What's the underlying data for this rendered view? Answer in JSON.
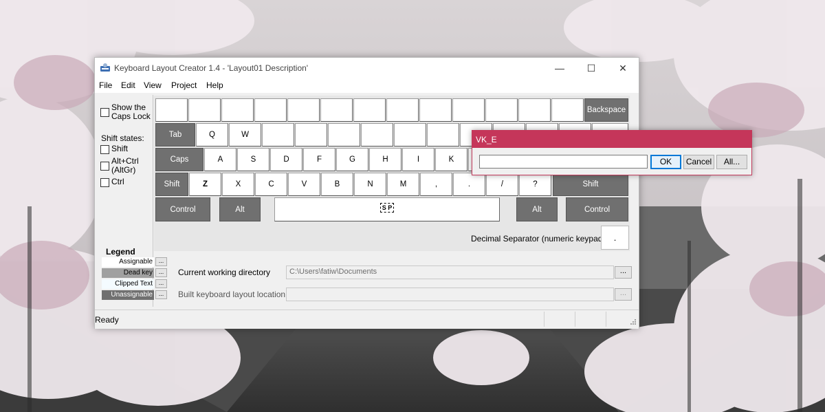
{
  "window": {
    "title": "Keyboard Layout Creator 1.4 - 'Layout01 Description'",
    "minimize_glyph": "—",
    "maximize_glyph": "☐",
    "close_glyph": "✕"
  },
  "menu": [
    "File",
    "Edit",
    "View",
    "Project",
    "Help"
  ],
  "options": {
    "caps_lock_label": [
      "Show the",
      "Caps Lock"
    ],
    "shift_states_label": "Shift states:",
    "shift_label": "Shift",
    "altgr_label": [
      "Alt+Ctrl",
      "(AltGr)"
    ],
    "ctrl_label": "Ctrl"
  },
  "keyboard": {
    "row0_backspace": "Backspace",
    "row1": [
      "Tab",
      "Q",
      "W"
    ],
    "row2": [
      "Caps",
      "A",
      "S",
      "D",
      "F",
      "G",
      "H",
      "I",
      "K"
    ],
    "row3": [
      "Shift",
      "Z",
      "X",
      "C",
      "V",
      "B",
      "N",
      "M",
      ",",
      ".",
      "/",
      "?",
      "Shift"
    ],
    "row4": [
      "Control",
      "Alt",
      "S P",
      "Alt",
      "Control"
    ]
  },
  "decimal": {
    "label": "Decimal Separator (numeric keypad)",
    "value": "."
  },
  "legend": {
    "title": "Legend",
    "items": [
      "Assignable",
      "Dead key",
      "Clipped Text",
      "Unassignable"
    ],
    "button_label": "...",
    "colors": [
      "#ffffff",
      "#a0a0a0",
      "#f4fbff",
      "#707070"
    ]
  },
  "directories": {
    "working_label": "Current working directory",
    "working_value": "C:\\Users\\fatiw\\Documents",
    "built_label": "Built keyboard layout location",
    "built_value": "",
    "browse_label": "..."
  },
  "status": {
    "text": "Ready"
  },
  "vk_dialog": {
    "title": "VK_E",
    "input_value": "",
    "ok_label": "OK",
    "cancel_label": "Cancel",
    "all_label": "All...",
    "accent_color": "#c5365a"
  }
}
